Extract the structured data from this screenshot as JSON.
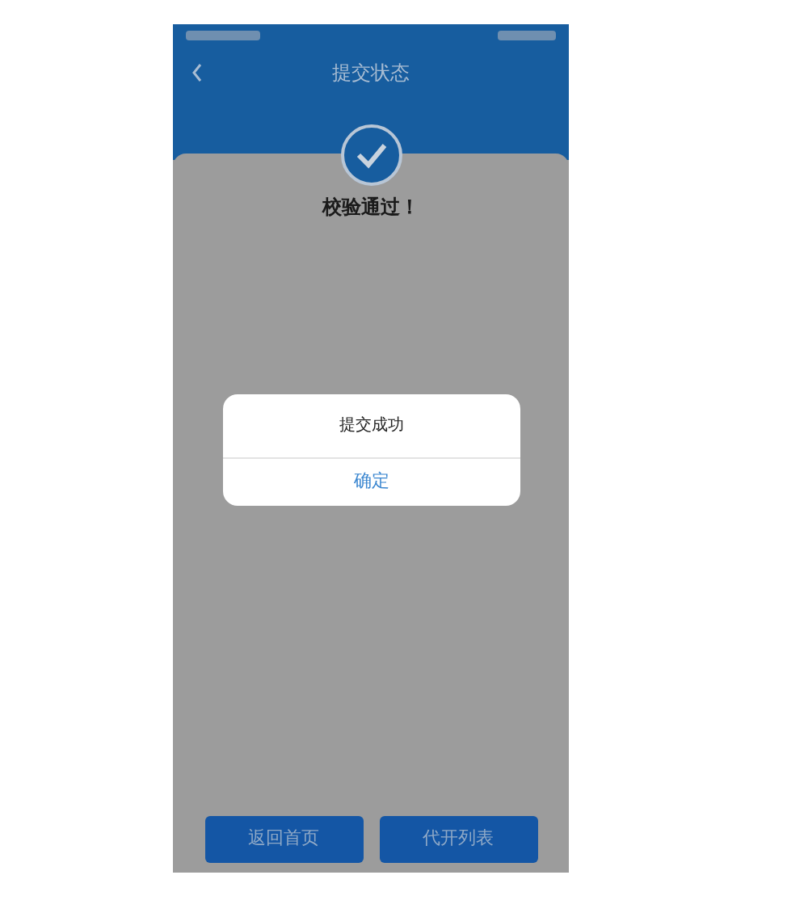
{
  "header": {
    "title": "提交状态"
  },
  "result": {
    "message": "校验通过！"
  },
  "buttons": [
    {
      "label": "返回首页"
    },
    {
      "label": "代开列表"
    }
  ],
  "dialog": {
    "message": "提交成功",
    "button": "确定"
  }
}
